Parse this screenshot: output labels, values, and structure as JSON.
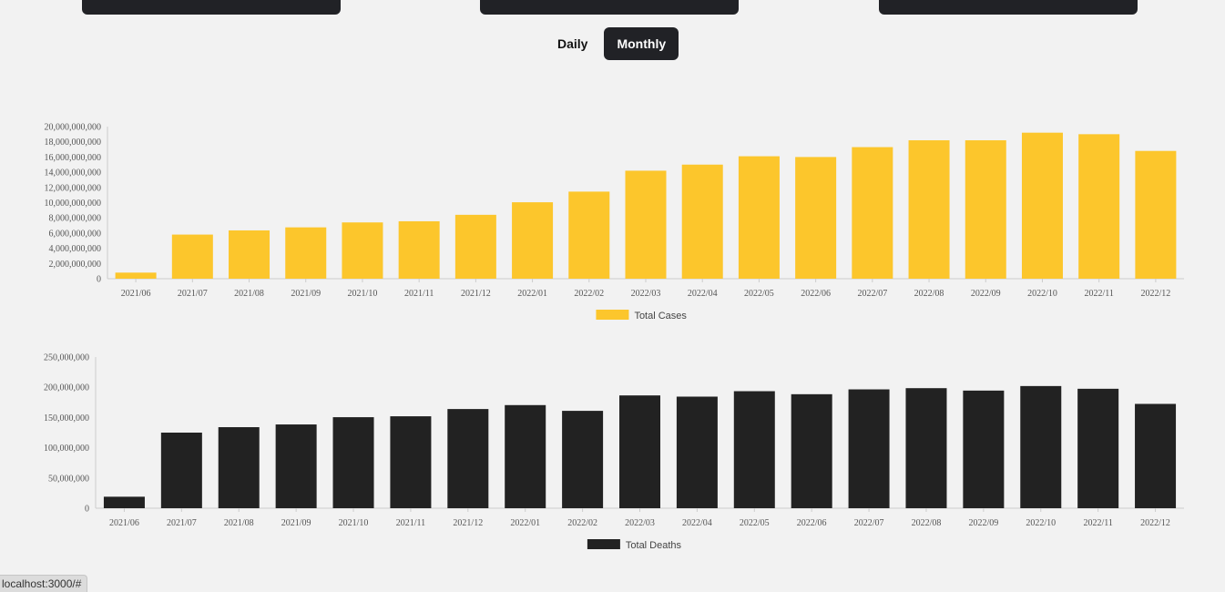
{
  "toggle": {
    "daily_label": "Daily",
    "monthly_label": "Monthly",
    "selected": "Monthly"
  },
  "status_bar": {
    "url": "localhost:3000/#"
  },
  "colors": {
    "cases": "#fcc62c",
    "deaths": "#222222",
    "card": "#212226"
  },
  "chart_data": [
    {
      "type": "bar",
      "categories": [
        "2021/06",
        "2021/07",
        "2021/08",
        "2021/09",
        "2021/10",
        "2021/11",
        "2021/12",
        "2022/01",
        "2022/02",
        "2022/03",
        "2022/04",
        "2022/05",
        "2022/06",
        "2022/07",
        "2022/08",
        "2022/09",
        "2022/10",
        "2022/11",
        "2022/12"
      ],
      "series": [
        {
          "name": "Total Cases",
          "values": [
            800000000,
            5800000000,
            6350000000,
            6750000000,
            7400000000,
            7550000000,
            8400000000,
            10050000000,
            11450000000,
            14200000000,
            15000000000,
            16100000000,
            16000000000,
            17300000000,
            18200000000,
            18200000000,
            19200000000,
            19000000000,
            16800000000
          ]
        }
      ],
      "ylim": [
        0,
        20000000000
      ],
      "yticks": [
        "0",
        "2,000,000,000",
        "4,000,000,000",
        "6,000,000,000",
        "8,000,000,000",
        "10,000,000,000",
        "12,000,000,000",
        "14,000,000,000",
        "16,000,000,000",
        "18,000,000,000",
        "20,000,000,000"
      ],
      "legend": "bottom"
    },
    {
      "type": "bar",
      "categories": [
        "2021/06",
        "2021/07",
        "2021/08",
        "2021/09",
        "2021/10",
        "2021/11",
        "2021/12",
        "2022/01",
        "2022/02",
        "2022/03",
        "2022/04",
        "2022/05",
        "2022/06",
        "2022/07",
        "2022/08",
        "2022/09",
        "2022/10",
        "2022/11",
        "2022/12"
      ],
      "series": [
        {
          "name": "Total Deaths",
          "values": [
            19000000,
            125000000,
            134000000,
            138500000,
            150500000,
            152000000,
            164000000,
            170500000,
            161000000,
            186500000,
            184500000,
            193500000,
            188500000,
            196500000,
            198500000,
            194500000,
            202000000,
            197500000,
            172500000
          ]
        }
      ],
      "ylim": [
        0,
        250000000
      ],
      "yticks": [
        "0",
        "50,000,000",
        "100,000,000",
        "150,000,000",
        "200,000,000",
        "250,000,000"
      ],
      "legend": "bottom"
    }
  ]
}
